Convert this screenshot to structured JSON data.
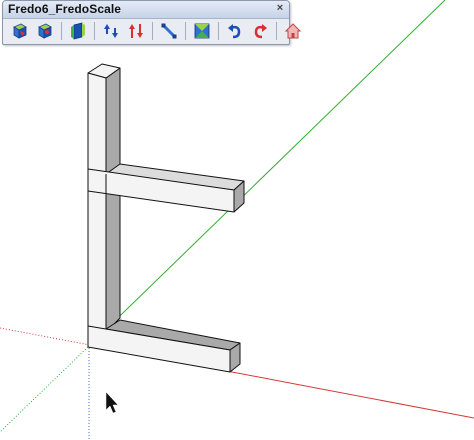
{
  "window": {
    "title": "Fredo6_FredoScale",
    "close_glyph": "×"
  },
  "toolbar": {
    "groups": [
      [
        "box-scale-icon",
        "box-scale-center-icon"
      ],
      [
        "plane-scale-icon"
      ],
      [
        "stretch-icon",
        "twist-icon"
      ],
      [
        "radial-bend-icon"
      ],
      [
        "taper-icon"
      ],
      [
        "undo-transform-icon",
        "redo-transform-icon"
      ],
      [
        "home-icon"
      ]
    ]
  },
  "colors": {
    "axis_red": "#d33a3a",
    "axis_green": "#2fae2f",
    "axis_blue": "#4a6fd8",
    "face_light": "#f4f4f4",
    "face_shade": "#a9a9a9",
    "edge": "#111111"
  }
}
